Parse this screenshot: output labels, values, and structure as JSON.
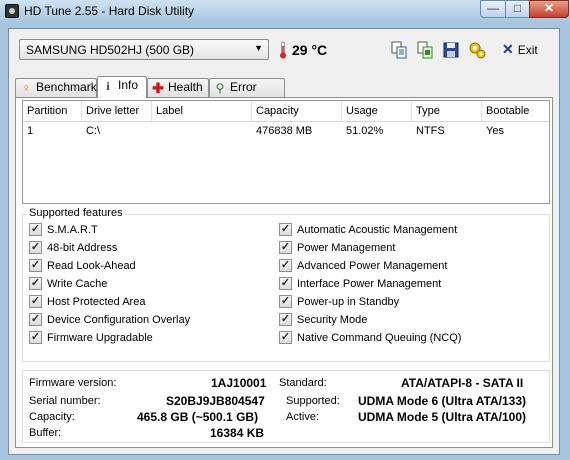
{
  "window": {
    "title": "HD Tune 2.55 - Hard Disk Utility",
    "min_glyph": "—",
    "max_glyph": "□",
    "close_glyph": "✕"
  },
  "toolbar": {
    "drive": "SAMSUNG HD502HJ (500 GB)",
    "temperature": "29 °C",
    "exit_label": "Exit",
    "icons": [
      "copy-icon",
      "copy-screenshot-icon",
      "save-icon",
      "options-icon"
    ]
  },
  "tabs": [
    {
      "label": "Benchmark",
      "icon": "benchmark-icon"
    },
    {
      "label": "Info",
      "icon": "info-icon"
    },
    {
      "label": "Health",
      "icon": "health-icon"
    },
    {
      "label": "Error Scan",
      "icon": "magnifier-icon"
    }
  ],
  "partitions": {
    "columns": [
      "Partition",
      "Drive letter",
      "Label",
      "Capacity",
      "Usage",
      "Type",
      "Bootable"
    ],
    "rows": [
      [
        "1",
        "C:\\",
        "",
        "476838 MB",
        "51.02%",
        "NTFS",
        "Yes"
      ]
    ]
  },
  "features": {
    "title": "Supported features",
    "left": [
      "S.M.A.R.T",
      "48-bit Address",
      "Read Look-Ahead",
      "Write Cache",
      "Host Protected Area",
      "Device Configuration Overlay",
      "Firmware Upgradable"
    ],
    "right": [
      "Automatic Acoustic Management",
      "Power Management",
      "Advanced Power Management",
      "Interface Power Management",
      "Power-up in Standby",
      "Security Mode",
      "Native Command Queuing (NCQ)"
    ]
  },
  "info": {
    "firmware_label": "Firmware version:",
    "firmware": "1AJ10001",
    "serial_label": "Serial number:",
    "serial": "S20BJ9JB804547",
    "capacity_label": "Capacity:",
    "capacity": "465.8 GB (~500.1 GB)",
    "buffer_label": "Buffer:",
    "buffer": "16384 KB",
    "standard_label": "Standard:",
    "standard": "ATA/ATAPI-8 - SATA II",
    "supported_label": "Supported:",
    "supported": "UDMA Mode 6 (Ultra ATA/133)",
    "active_label": "Active:",
    "active": "UDMA Mode 5 (Ultra ATA/100)"
  }
}
